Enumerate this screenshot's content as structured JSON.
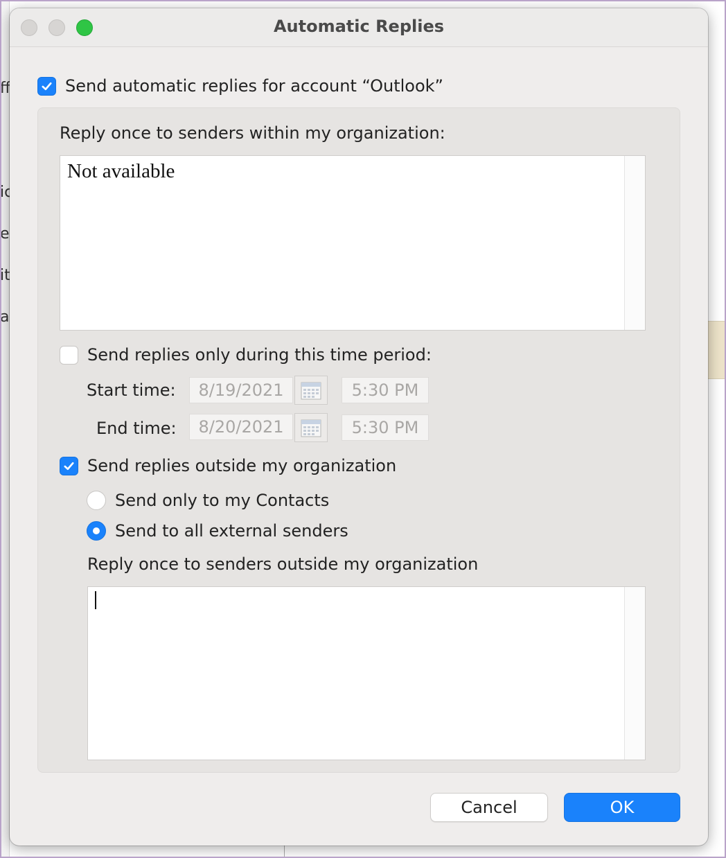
{
  "window": {
    "title": "Automatic Replies"
  },
  "background": {
    "left_snippets": [
      "ff",
      "ic",
      "e",
      "it",
      "ac"
    ]
  },
  "main_toggle": {
    "label": "Send automatic replies for account “Outlook”",
    "checked": true
  },
  "internal": {
    "heading": "Reply once to senders within my organization:",
    "message": "Not available"
  },
  "time_period": {
    "label": "Send replies only during this time period:",
    "checked": false,
    "start_label": "Start time:",
    "start_date": "8/19/2021",
    "start_time": "5:30 PM",
    "end_label": "End time:",
    "end_date": "8/20/2021",
    "end_time": "5:30 PM"
  },
  "external": {
    "label": "Send replies outside my organization",
    "checked": true,
    "option_contacts": "Send only to my Contacts",
    "option_all": "Send to all external senders",
    "selected": "all",
    "heading": "Reply once to senders outside my organization",
    "message": ""
  },
  "buttons": {
    "cancel": "Cancel",
    "ok": "OK"
  },
  "colors": {
    "accent": "#1a82fb",
    "window_bg": "#efedec",
    "panel_bg": "#e6e4e2",
    "maximize": "#2fc545"
  },
  "icons": {
    "check": "checkmark-icon",
    "calendar": "calendar-icon"
  }
}
